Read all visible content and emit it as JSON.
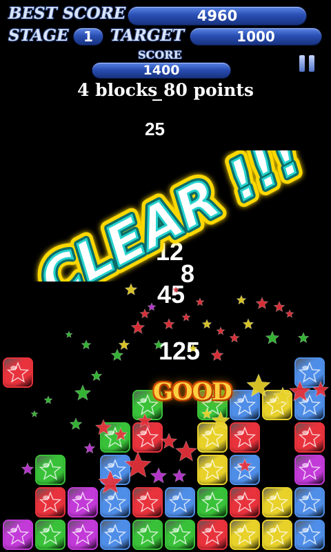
{
  "hud": {
    "best_score_label": "BEST SCORE",
    "best_score_value": "4960",
    "stage_label": "STAGE",
    "stage_value": "1",
    "target_label": "TARGET",
    "target_value": "1000",
    "score_label": "SCORE",
    "score_value": "1400"
  },
  "message": "4 blocks 80 points",
  "popup_points": [
    "25",
    "12",
    "8",
    "45",
    "125"
  ],
  "clear_text": "CLEAR !!!",
  "good_text": "GOOD",
  "colors": {
    "red": "#e8323c",
    "blue": "#4f8ee8",
    "green": "#39c239",
    "yellow": "#e8d22a",
    "purple": "#c23ad8"
  },
  "board": {
    "columns": 10,
    "rows": [
      [
        "red",
        "",
        "",
        "",
        "",
        "",
        "",
        "",
        "",
        "blue"
      ],
      [
        "",
        "",
        "",
        "",
        "green",
        "",
        "green",
        "blue",
        "yellow",
        "blue"
      ],
      [
        "",
        "",
        "",
        "green",
        "red",
        "",
        "yellow",
        "red",
        "",
        "red"
      ],
      [
        "",
        "green",
        "",
        "blue",
        "",
        "",
        "yellow",
        "blue",
        "",
        "purple"
      ],
      [
        "",
        "red",
        "purple",
        "blue",
        "red",
        "blue",
        "green",
        "red",
        "yellow",
        "blue"
      ],
      [
        "purple",
        "green",
        "purple",
        "blue",
        "green",
        "green",
        "red",
        "yellow",
        "yellow",
        "blue"
      ]
    ]
  }
}
